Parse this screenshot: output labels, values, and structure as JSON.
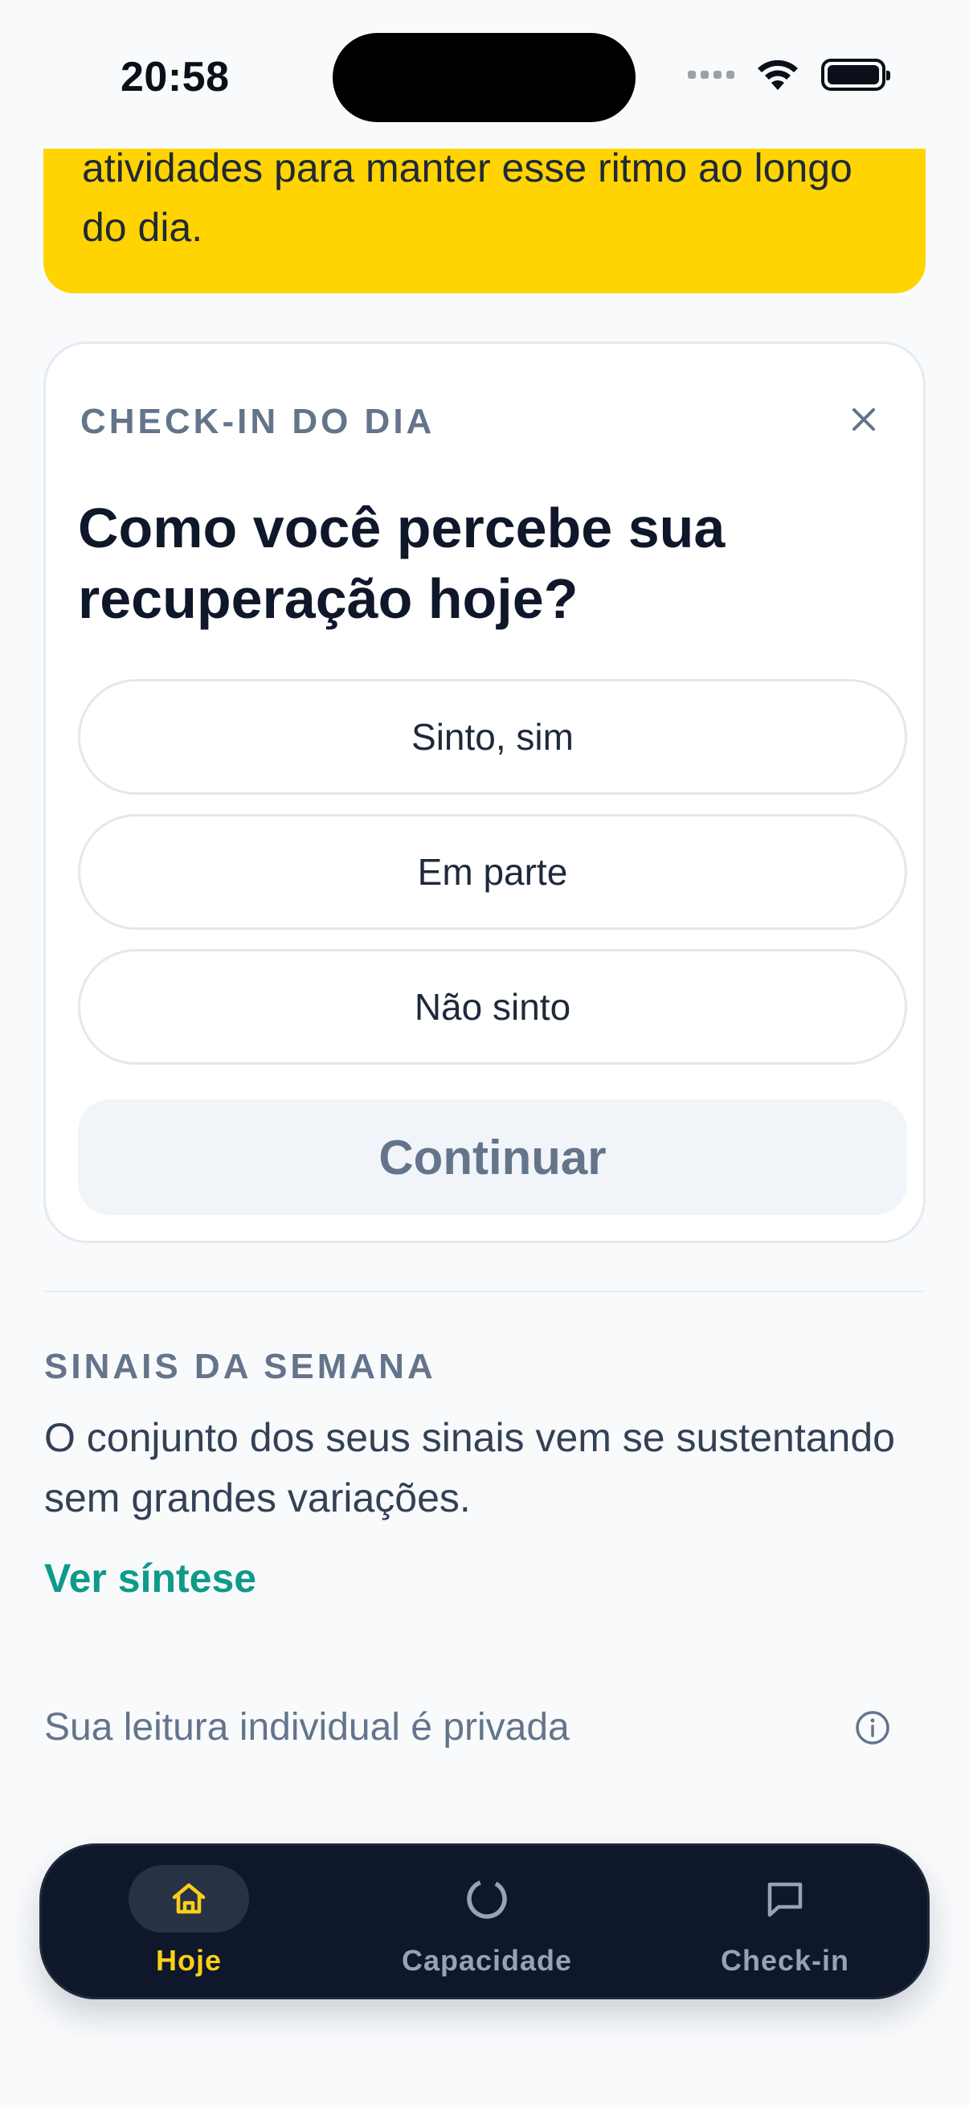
{
  "status_bar": {
    "time": "20:58"
  },
  "summary_card": {
    "text": "atividades para manter esse ritmo ao longo do dia."
  },
  "checkin": {
    "kicker": "CHECK-IN DO DIA",
    "question": "Como você percebe sua recuperação hoje?",
    "options": [
      "Sinto, sim",
      "Em parte",
      "Não sinto"
    ],
    "continue_label": "Continuar"
  },
  "signals": {
    "kicker": "SINAIS DA SEMANA",
    "text": "O conjunto dos seus sinais vem se sustentando sem grandes variações.",
    "link": "Ver síntese"
  },
  "privacy": {
    "text": "Sua leitura individual é privada"
  },
  "tabs": [
    {
      "label": "Hoje",
      "icon": "home-icon",
      "active": true
    },
    {
      "label": "Capacidade",
      "icon": "capacity-ring-icon",
      "active": false
    },
    {
      "label": "Check-in",
      "icon": "chat-icon",
      "active": false
    }
  ],
  "colors": {
    "accent_yellow": "#FFD400",
    "link_teal": "#0F9A8A",
    "tabbar_bg": "#0F172A",
    "tab_active": "#FBCF18"
  }
}
